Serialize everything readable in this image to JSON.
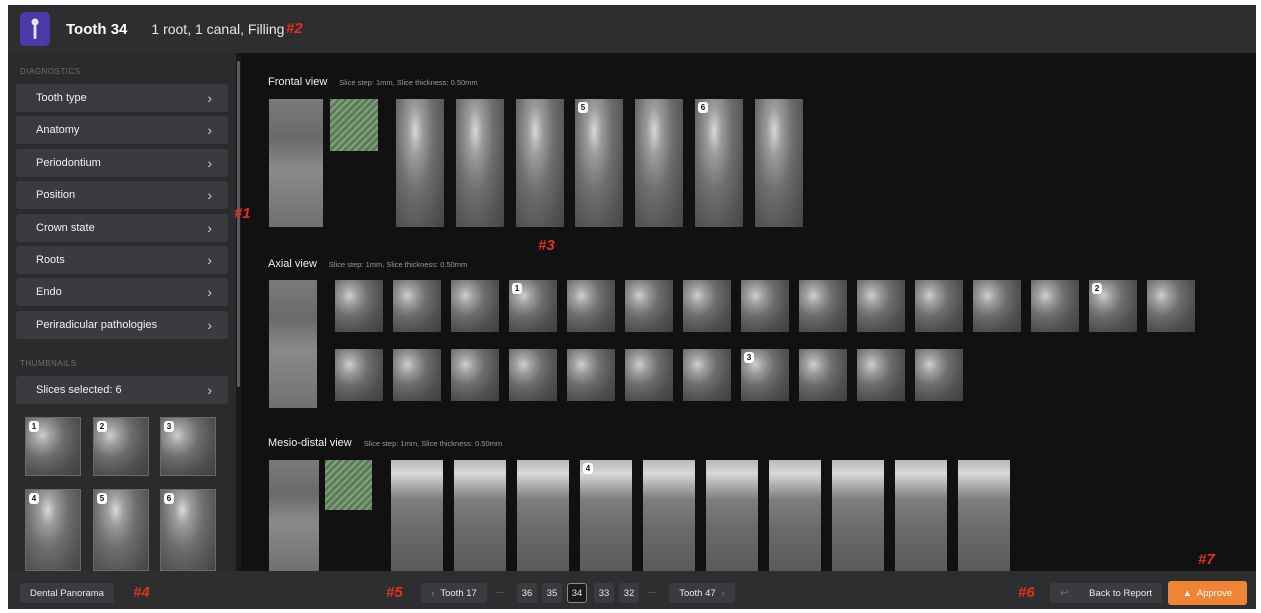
{
  "header": {
    "title": "Tooth 34",
    "description": "1 root, 1 canal, Filling",
    "marker": "#2"
  },
  "sidebar": {
    "diagnostics_label": "DIAGNOSTICS",
    "items": [
      {
        "label": "Tooth type"
      },
      {
        "label": "Anatomy"
      },
      {
        "label": "Periodontium"
      },
      {
        "label": "Position"
      },
      {
        "label": "Crown state"
      },
      {
        "label": "Roots"
      },
      {
        "label": "Endo"
      },
      {
        "label": "Periradicular pathologies"
      }
    ],
    "thumbnails_label": "THUMBNAILS",
    "slices_selected": "Slices selected: 6",
    "thumbnails": [
      "1",
      "2",
      "3",
      "4",
      "5",
      "6"
    ],
    "marker": "#1"
  },
  "main": {
    "marker": "#3",
    "frontal": {
      "title": "Frontal view",
      "meta": "Slice step: 1mm, Slice thickness: 0.50mm",
      "badges": {
        "slice_4": "5",
        "slice_6": "6"
      }
    },
    "axial": {
      "title": "Axial view",
      "meta": "Slice step: 1mm, Slice thickness: 0.50mm",
      "badges": {
        "row1_4": "1",
        "row1_14": "2",
        "row2_8": "3"
      }
    },
    "mesio_distal": {
      "title": "Mesio-distal view",
      "meta": "Slice step: 1mm, Slice thickness: 0.50mm",
      "badges": {
        "slice_4": "4"
      }
    }
  },
  "footer": {
    "panorama_label": "Dental Panorama",
    "marker_4": "#4",
    "marker_5": "#5",
    "prev_label": "Tooth 17",
    "next_label": "Tooth 47",
    "pages": [
      "36",
      "35",
      "34",
      "33",
      "32"
    ],
    "active_page": "34",
    "ellipsis": "...",
    "marker_6": "#6",
    "back_label": "Back to Report",
    "approve_label": "Approve",
    "marker_7": "#7"
  },
  "colors": {
    "accent": "#ef8435",
    "marker": "#e0301e",
    "logo_bg": "#4a3aa8"
  }
}
